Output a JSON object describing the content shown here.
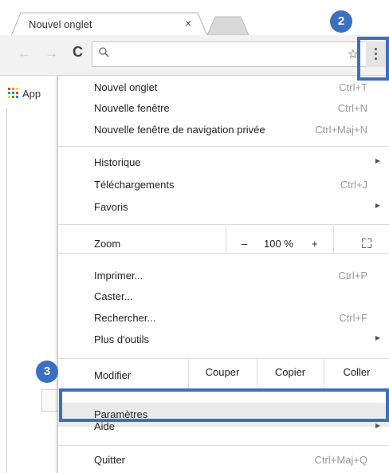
{
  "tab": {
    "title": "Nouvel onglet",
    "close": "×"
  },
  "toolbar": {
    "back": "←",
    "forward": "→",
    "reload": "C",
    "search_icon": "⚲",
    "star_icon": "☆"
  },
  "bookmarks": {
    "apps_label": "App"
  },
  "menu": {
    "group1": [
      {
        "label": "Nouvel onglet",
        "shortcut": "Ctrl+T"
      },
      {
        "label": "Nouvelle fenêtre",
        "shortcut": "Ctrl+N"
      },
      {
        "label": "Nouvelle fenêtre de navigation privée",
        "shortcut": "Ctrl+Maj+N"
      }
    ],
    "group2": [
      {
        "label": "Historique",
        "shortcut": "",
        "submenu": true
      },
      {
        "label": "Téléchargements",
        "shortcut": "Ctrl+J"
      },
      {
        "label": "Favoris",
        "shortcut": "",
        "submenu": true
      }
    ],
    "zoom": {
      "label": "Zoom",
      "minus": "–",
      "value": "100 %",
      "plus": "+"
    },
    "group3": [
      {
        "label": "Imprimer...",
        "shortcut": "Ctrl+P"
      },
      {
        "label": "Caster...",
        "shortcut": ""
      },
      {
        "label": "Rechercher...",
        "shortcut": "Ctrl+F"
      },
      {
        "label": "Plus d'outils",
        "shortcut": "",
        "submenu": true
      }
    ],
    "edit": {
      "label": "Modifier",
      "cut": "Couper",
      "copy": "Copier",
      "paste": "Coller"
    },
    "settings": "Paramètres",
    "help": "Aide",
    "quit": {
      "label": "Quitter",
      "shortcut": "Ctrl+Maj+Q"
    }
  },
  "annotations": {
    "step2": "2",
    "step3": "3",
    "color": "#3a6fc4"
  }
}
